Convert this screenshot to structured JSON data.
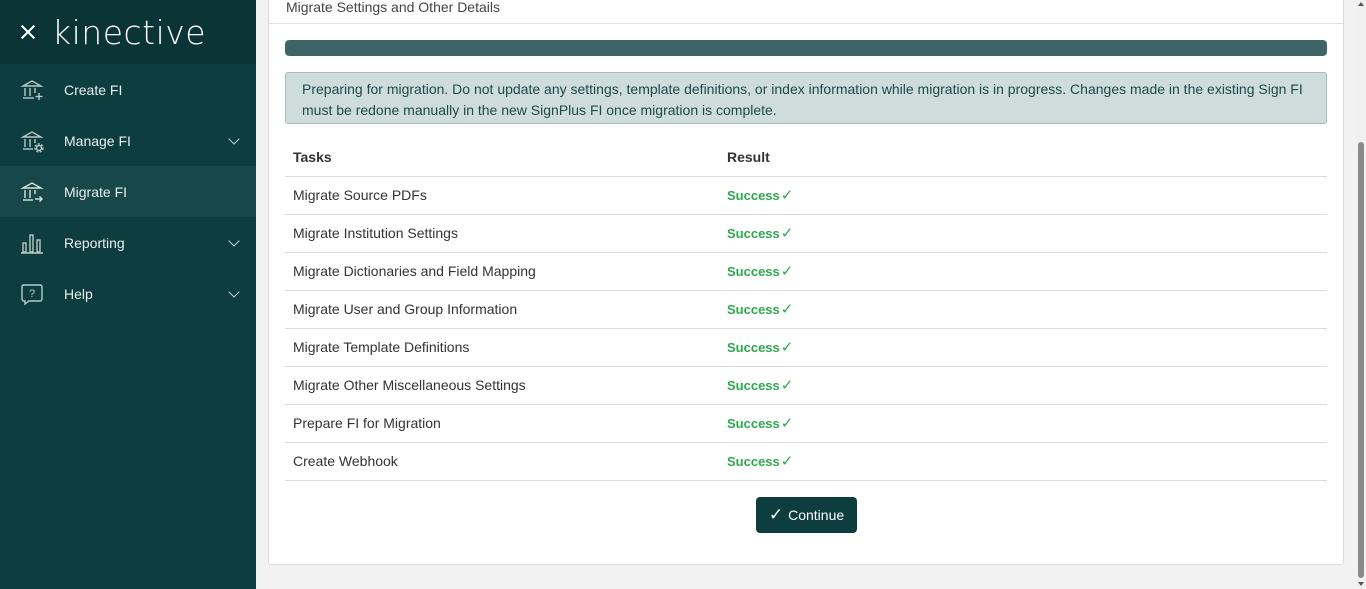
{
  "brand": {
    "logo_text": "kinective"
  },
  "sidebar": {
    "items": [
      {
        "label": "Create FI",
        "icon": "bank-plus-icon"
      },
      {
        "label": "Manage FI",
        "icon": "bank-gear-icon"
      },
      {
        "label": "Migrate FI",
        "icon": "bank-arrow-icon",
        "active": true
      },
      {
        "label": "Reporting",
        "icon": "bar-chart-icon"
      },
      {
        "label": "Help",
        "icon": "help-bubble-icon"
      }
    ]
  },
  "main": {
    "title": "Migrate Settings and Other Details",
    "progress_fraction": 1.0,
    "alert": "Preparing for migration. Do not update any settings, template definitions, or index information while migration is in progress. Changes made in the existing Sign FI must be redone manually in the new SignPlus FI once migration is complete.",
    "table": {
      "headers": [
        "Tasks",
        "Result"
      ],
      "rows": [
        {
          "task": "Migrate Source PDFs",
          "result": "Success"
        },
        {
          "task": "Migrate Institution Settings",
          "result": "Success"
        },
        {
          "task": "Migrate Dictionaries and Field Mapping",
          "result": "Success"
        },
        {
          "task": "Migrate User and Group Information",
          "result": "Success"
        },
        {
          "task": "Migrate Template Definitions",
          "result": "Success"
        },
        {
          "task": "Migrate Other Miscellaneous Settings",
          "result": "Success"
        },
        {
          "task": "Prepare FI for Migration",
          "result": "Success"
        },
        {
          "task": "Create Webhook",
          "result": "Success"
        }
      ]
    },
    "continue_label": "Continue",
    "check_glyph": "✓"
  },
  "colors": {
    "sidebar_bg": "#0e3d3f",
    "success": "#2fa84f",
    "accent": "#3e6466"
  }
}
